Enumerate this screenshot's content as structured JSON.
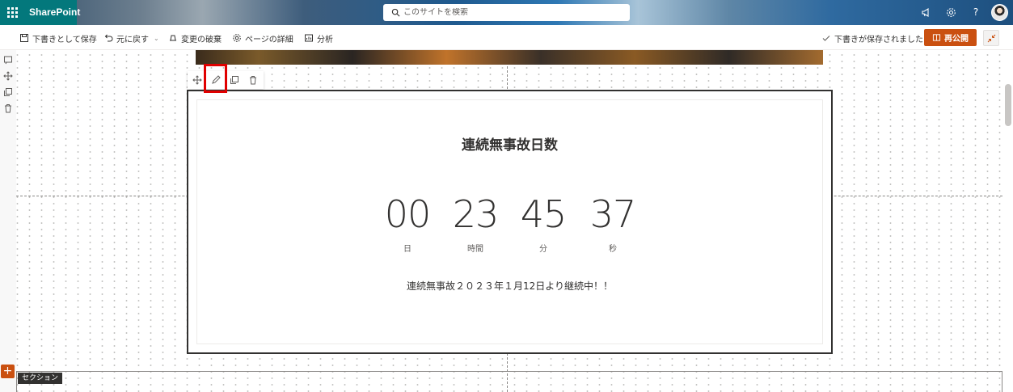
{
  "suitebar": {
    "app_name": "SharePoint",
    "search_placeholder": "このサイトを検索",
    "icons": [
      "waffle-icon",
      "megaphone-icon",
      "settings-icon",
      "help-icon",
      "avatar"
    ]
  },
  "commandbar": {
    "save_draft": "下書きとして保存",
    "undo": "元に戻す",
    "discard": "変更の破棄",
    "page_details": "ページの詳細",
    "analytics": "分析",
    "saved_status": "下書きが保存されました",
    "republish": "再公開"
  },
  "webpart": {
    "title": "連続無事故日数",
    "countdown": [
      {
        "value": "00",
        "unit": "日"
      },
      {
        "value": "23",
        "unit": "時間"
      },
      {
        "value": "45",
        "unit": "分"
      },
      {
        "value": "37",
        "unit": "秒"
      }
    ],
    "message": "連続無事故２０２３年１月12日より継続中！！"
  },
  "section": {
    "label": "セクション",
    "add_symbol": "+"
  },
  "colors": {
    "brand_teal": "#03787c",
    "accent_orange": "#ca5010",
    "highlight_red": "#e00000"
  }
}
